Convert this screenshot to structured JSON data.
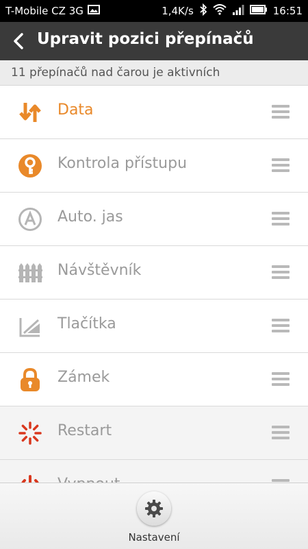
{
  "status_bar": {
    "carrier": "T-Mobile CZ 3G",
    "speed": "1,4K/s",
    "time": "16:51"
  },
  "header": {
    "title": "Upravit pozici přepínačů"
  },
  "subheader": {
    "text": "11 přepínačů nad čarou je aktivních"
  },
  "toggles": [
    {
      "label": "Data",
      "icon": "data-transfer-icon",
      "color": "#e9892a",
      "active": true
    },
    {
      "label": "Kontrola přístupu",
      "icon": "key-icon",
      "color": "#e9892a"
    },
    {
      "label": "Auto. jas",
      "icon": "auto-brightness-icon",
      "color": "#b5b5b5"
    },
    {
      "label": "Návštěvník",
      "icon": "fence-icon",
      "color": "#b5b5b5"
    },
    {
      "label": "Tlačítka",
      "icon": "buttons-icon",
      "color": "#b5b5b5"
    },
    {
      "label": "Zámek",
      "icon": "lock-icon",
      "color": "#e9892a"
    },
    {
      "label": "Restart",
      "icon": "restart-icon",
      "color": "#d9381e"
    },
    {
      "label": "Vypnout",
      "icon": "power-icon",
      "color": "#d9381e"
    }
  ],
  "bottom": {
    "settings_label": "Nastavení"
  },
  "colors": {
    "accent": "#e9892a",
    "danger": "#d9381e",
    "header_bg": "#3a3a3a"
  }
}
